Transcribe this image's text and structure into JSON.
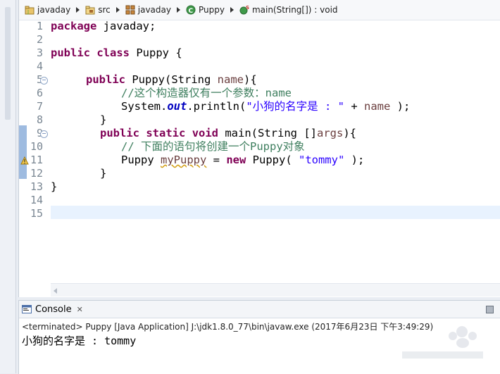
{
  "breadcrumb": {
    "items": [
      {
        "label": "javaday",
        "icon": "project-icon"
      },
      {
        "label": "src",
        "icon": "source-folder-icon"
      },
      {
        "label": "javaday",
        "icon": "package-icon"
      },
      {
        "label": "Puppy",
        "icon": "class-icon"
      },
      {
        "label": "main(String[]) : void",
        "icon": "static-method-icon"
      }
    ]
  },
  "editor": {
    "line_numbers": [
      "1",
      "2",
      "3",
      "4",
      "5",
      "6",
      "7",
      "8",
      "9",
      "10",
      "11",
      "12",
      "13",
      "14",
      "15"
    ],
    "code": {
      "l1_kw": "package",
      "l1_rest": " javaday;",
      "l3_kw1": "public",
      "l3_kw2": "class",
      "l3_rest": " Puppy {",
      "l5_kw": "public",
      "l5_a": " Puppy(String ",
      "l5_param": "name",
      "l5_b": "){",
      "l6_comment": "//这个构造器仅有一个参数：name",
      "l7_a": "System.",
      "l7_field": "out",
      "l7_b": ".println(",
      "l7_str": "\"小狗的名字是 : \"",
      "l7_c": " + ",
      "l7_var": "name",
      "l7_d": " );",
      "l8": "}",
      "l9_kw1": "public",
      "l9_kw2": "static",
      "l9_kw3": "void",
      "l9_a": " main(String []",
      "l9_param": "args",
      "l9_b": "){",
      "l10_comment": "// 下面的语句将创建一个Puppy对象",
      "l11_a": "Puppy ",
      "l11_var": "myPuppy",
      "l11_b": " = ",
      "l11_kw": "new",
      "l11_c": " Puppy( ",
      "l11_str": "\"tommy\"",
      "l11_d": " );",
      "l12": "}",
      "l13": "}"
    }
  },
  "console": {
    "tab_label": "Console",
    "close_glyph": "✕",
    "terminated_line": "<terminated> Puppy [Java Application] J:\\jdk1.8.0_77\\bin\\javaw.exe (2017年6月23日 下午3:49:29)",
    "output_line": "小狗的名字是 : tommy"
  },
  "colors": {
    "keyword": "#7f0055",
    "string": "#2a00ff",
    "comment": "#3f7f5f",
    "field": "#0000c0",
    "current_line": "#e8f2fe"
  }
}
